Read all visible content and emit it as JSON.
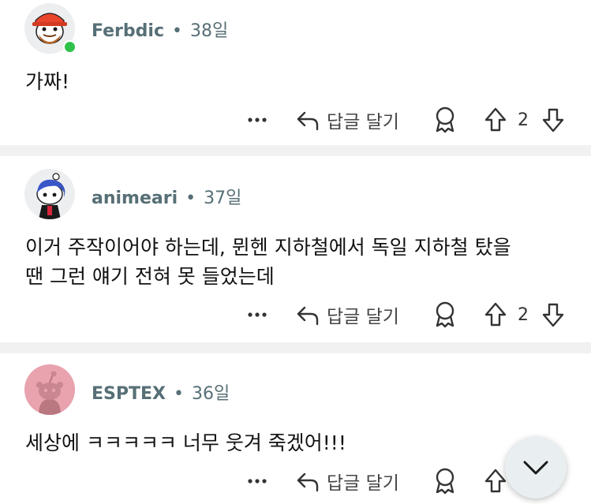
{
  "comments": [
    {
      "username": "Ferbdic",
      "separator": "•",
      "time": "38일",
      "text": "가짜!",
      "reply_label": "답글 달기",
      "votes": "2",
      "online": true,
      "avatar_icon": "ferbdic-avatar-icon"
    },
    {
      "username": "animeari",
      "separator": "•",
      "time": "37일",
      "text_lines": [
        "이거 주작이어야 하는데, 뮌헨 지하철에서 독일 지하철 탔을",
        "땐 그런 얘기 전혀 못 들었는데"
      ],
      "reply_label": "답글 달기",
      "votes": "2",
      "avatar_icon": "animeari-avatar-icon"
    },
    {
      "username": "ESPTEX",
      "separator": "•",
      "time": "36일",
      "text": "세상에 ㅋㅋㅋㅋㅋ 너무 웃겨 죽겠어!!!",
      "reply_label": "답글 달기",
      "avatar_icon": "esptex-avatar-icon"
    }
  ],
  "colors": {
    "meta": "#576f76",
    "separator_band": "#f1f1f1",
    "online": "#2fc24b",
    "fab_bg": "#e9eef0"
  },
  "fab": {
    "icon": "chevron-down-icon"
  }
}
